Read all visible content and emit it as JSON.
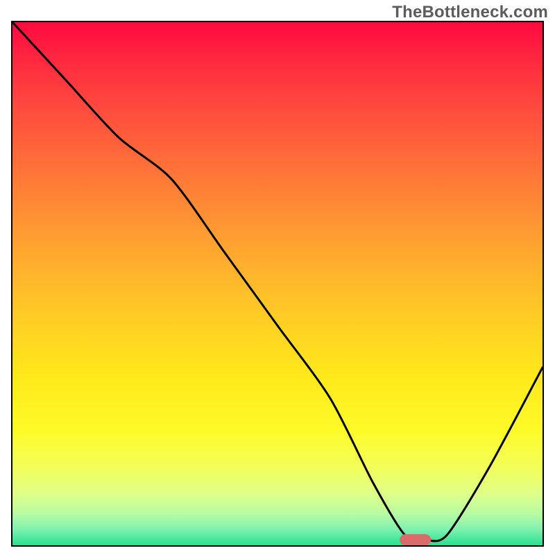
{
  "watermark": "TheBottleneck.com",
  "chart_data": {
    "type": "line",
    "title": "",
    "xlabel": "",
    "ylabel": "",
    "xlim": [
      0,
      100
    ],
    "ylim": [
      0,
      100
    ],
    "grid": false,
    "legend": false,
    "series": [
      {
        "name": "bottleneck-curve",
        "x": [
          0,
          10,
          20,
          30,
          40,
          50,
          60,
          68,
          74,
          78,
          82,
          90,
          100
        ],
        "y": [
          100,
          89,
          78,
          70,
          56,
          42,
          28,
          12,
          2,
          1,
          2,
          15,
          34
        ]
      }
    ],
    "marker": {
      "name": "optimal-range",
      "x_center": 76,
      "y": 1,
      "width_pct": 6
    },
    "background_scale": {
      "top_color": "#ff0a3f",
      "bottom_color": "#27e08e",
      "meaning_top": "high-bottleneck",
      "meaning_bottom": "no-bottleneck"
    }
  }
}
